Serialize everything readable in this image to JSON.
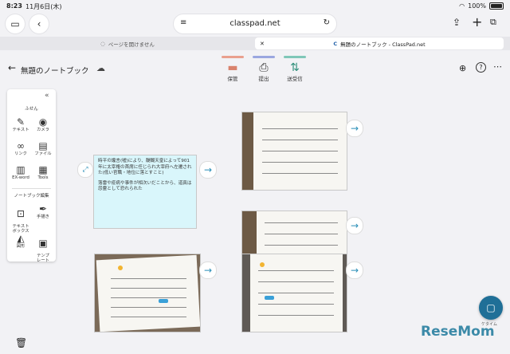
{
  "status_bar": {
    "time": "8:23",
    "date": "11月6日(木)",
    "battery": "100%"
  },
  "browser": {
    "address": "classpad.net",
    "tabs": [
      {
        "label": "ページを開けません"
      },
      {
        "label": "無題のノートブック - ClassPad.net"
      }
    ]
  },
  "app": {
    "notebook_title": "無題のノートブック",
    "toolbar": [
      {
        "label": "保管",
        "color": "#e9a08e"
      },
      {
        "label": "提出",
        "color": "#9aa7e0"
      },
      {
        "label": "送受信",
        "color": "#7fc7b8"
      }
    ]
  },
  "palette": {
    "section_sticky": "ふせん",
    "sticky_items": [
      {
        "label": "テキスト",
        "icon": "text-note-icon"
      },
      {
        "label": "カメラ",
        "icon": "camera-icon"
      },
      {
        "label": "リンク",
        "icon": "link-icon"
      },
      {
        "label": "ファイル",
        "icon": "file-icon"
      },
      {
        "label": "EX-word",
        "icon": "dictionary-icon"
      },
      {
        "label": "Tools",
        "icon": "tools-icon"
      }
    ],
    "section_edit": "ノートブック編集",
    "edit_items": [
      {
        "label": "テキスト\nボックス",
        "icon": "textbox-icon"
      },
      {
        "label": "手描き",
        "icon": "pen-icon"
      },
      {
        "label": "図形",
        "icon": "shapes-icon"
      },
      {
        "label": "テンプ\nレート",
        "icon": "template-icon"
      }
    ]
  },
  "note_card": {
    "text1": "時平の讒言(嘘)により、醍醐天皇によって901年に太宰権の首席に任じられ大宰府へ左遷された(低い官職・地位に落とすこと)",
    "text2": "落雷や疫病や事件が相次いだことから、道真は怨霊として恐れられた"
  },
  "fab_caption": "ケタイム",
  "watermark": "ReseMom"
}
